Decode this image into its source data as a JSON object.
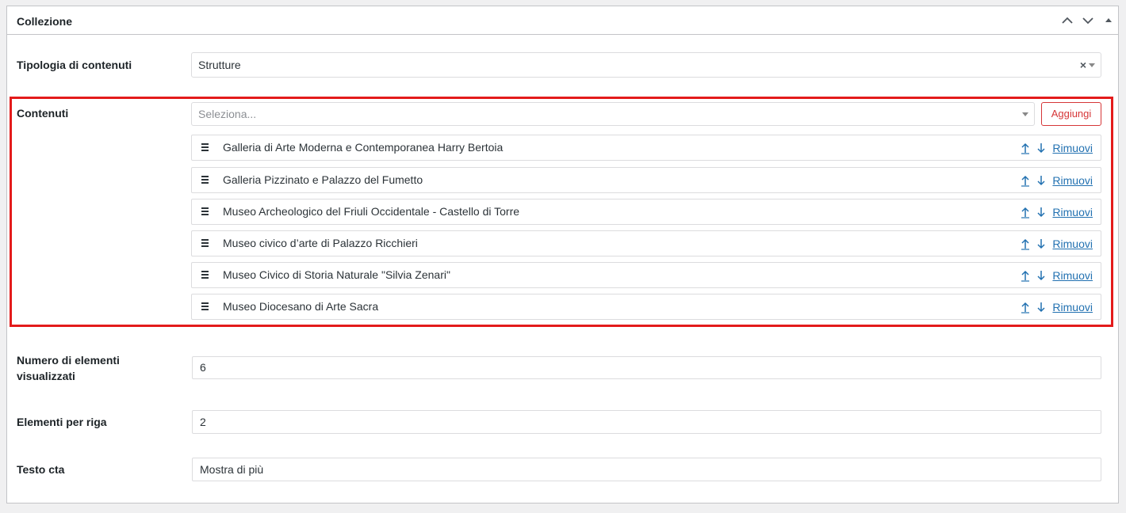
{
  "panel": {
    "title": "Collezione"
  },
  "colors": {
    "accent": "#2271b1",
    "danger": "#d63638",
    "highlight": "#e31b1b",
    "border": "#dcdcde"
  },
  "fields": {
    "tipologia": {
      "label": "Tipologia di contenuti",
      "value": "Strutture",
      "clear_glyph": "×"
    },
    "contenuti": {
      "label": "Contenuti",
      "placeholder": "Seleziona...",
      "add_label": "Aggiungi",
      "remove_label": "Rimuovi",
      "items": [
        "Galleria di Arte Moderna e Contemporanea Harry Bertoia",
        "Galleria Pizzinato e Palazzo del Fumetto",
        "Museo Archeologico del Friuli Occidentale - Castello di Torre",
        "Museo civico d’arte di Palazzo Ricchieri",
        "Museo Civico di Storia Naturale \"Silvia Zenari\"",
        "Museo Diocesano di Arte Sacra"
      ]
    },
    "numero": {
      "label_line1": "Numero di elementi",
      "label_line2": "visualizzati",
      "value": "6"
    },
    "per_riga": {
      "label": "Elementi per riga",
      "value": "2"
    },
    "cta": {
      "label": "Testo cta",
      "value": "Mostra di più"
    }
  },
  "icons": {
    "header": [
      "chevron-up-icon",
      "chevron-down-icon",
      "triangle-up-icon"
    ],
    "item": [
      "drag-handle-icon",
      "arrow-up-icon",
      "arrow-down-icon"
    ]
  }
}
